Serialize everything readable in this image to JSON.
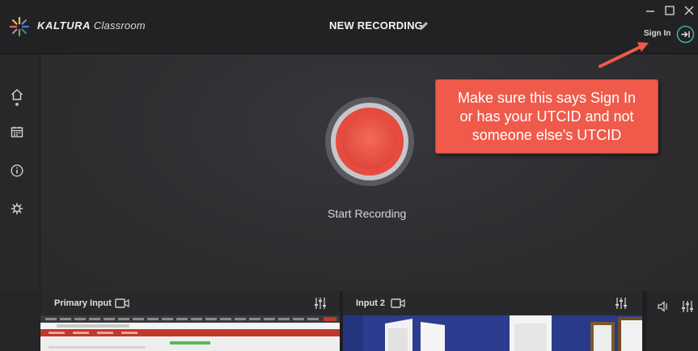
{
  "app": {
    "brand_bold": "KALTURA",
    "brand_light": "Classroom"
  },
  "header": {
    "title": "NEW RECORDING",
    "sign_in": "Sign In"
  },
  "main": {
    "start_label": "Start Recording"
  },
  "callout": {
    "lines": [
      "Make sure this says Sign In",
      "or has your UTCID and not",
      "someone else's UTCID"
    ]
  },
  "inputs": [
    {
      "label": "Primary Input"
    },
    {
      "label": "Input 2"
    }
  ],
  "icons": {
    "logo": "kaltura-logo-icon",
    "edit": "pencil-icon",
    "window": [
      "minimize-icon",
      "maximize-icon",
      "close-icon"
    ],
    "sign_in": "sign-in-icon",
    "sidebar": [
      "home-icon",
      "calendar-icon",
      "info-icon",
      "gear-icon"
    ],
    "input": [
      "camera-icon",
      "mixer-icon"
    ],
    "audio": [
      "speaker-icon",
      "mixer-icon"
    ]
  },
  "colors": {
    "record": "#e0483c",
    "callout": "#ef5a4b",
    "arrow": "#ef5a4b",
    "signin_ring": "#3fae8e"
  }
}
